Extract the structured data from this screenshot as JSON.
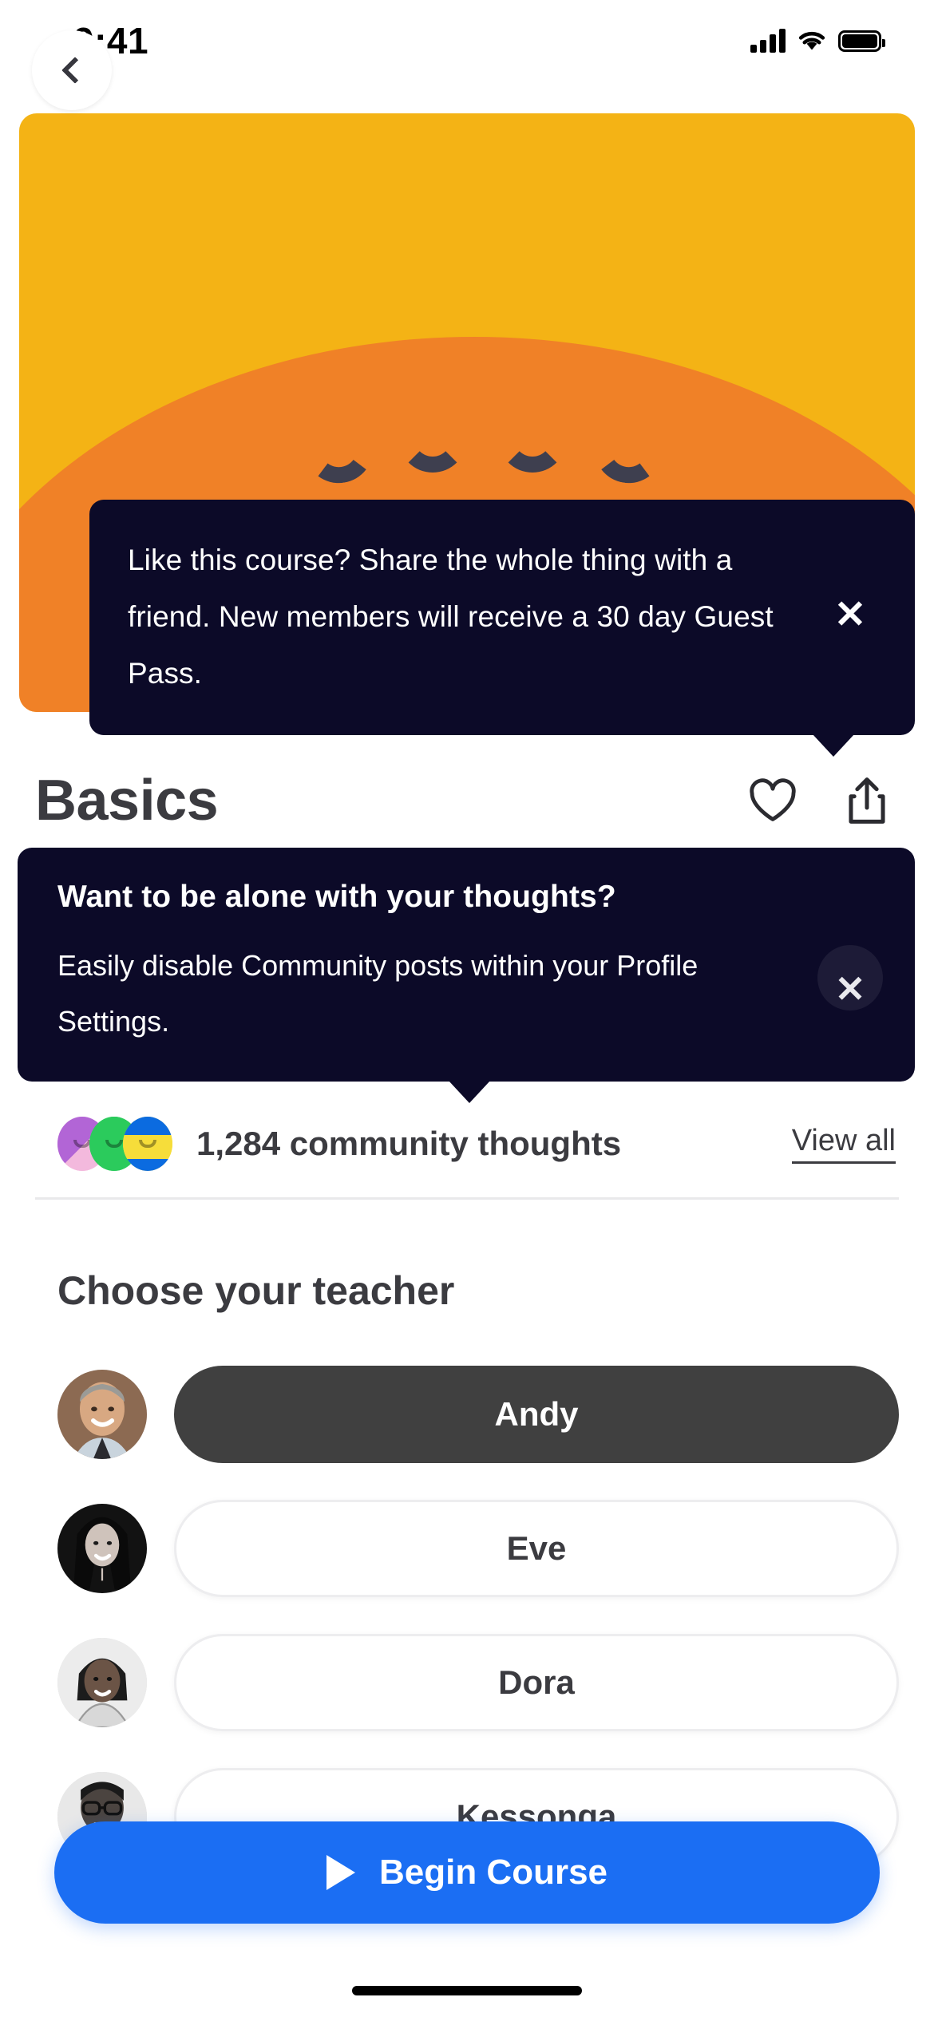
{
  "status_bar": {
    "time": "9:41",
    "cellular_icon": "signal-bars-icon",
    "wifi_icon": "wifi-icon",
    "battery_icon": "battery-full-icon"
  },
  "hero": {
    "back_icon": "chevron-left-icon",
    "background_color": "#F4B315",
    "blob_color": "#F08127"
  },
  "share_tooltip": {
    "message": "Like this course? Share the whole thing with a friend. New members will receive a 30 day Guest Pass.",
    "close_icon": "close-icon",
    "background_color": "#0C0A28"
  },
  "header": {
    "title": "Basics",
    "favorite_icon": "heart-icon",
    "share_icon": "share-icon"
  },
  "community_tooltip": {
    "heading": "Want to be alone with your thoughts?",
    "body": "Easily disable Community posts within your Profile Settings.",
    "close_icon": "close-icon",
    "background_color": "#0C0A28"
  },
  "community": {
    "count_label": "1,284 community thoughts",
    "view_all_label": "View all",
    "avatar_colors": [
      "#B265D6",
      "#2BCB5C",
      "#F6DD3A"
    ]
  },
  "teachers_section": {
    "title": "Choose your teacher",
    "items": [
      {
        "name": "Andy",
        "selected": true
      },
      {
        "name": "Eve",
        "selected": false
      },
      {
        "name": "Dora",
        "selected": false
      },
      {
        "name": "Kessonga",
        "selected": false
      }
    ]
  },
  "cta": {
    "label": "Begin Course",
    "play_icon": "play-icon",
    "color": "#1B6EF3"
  }
}
